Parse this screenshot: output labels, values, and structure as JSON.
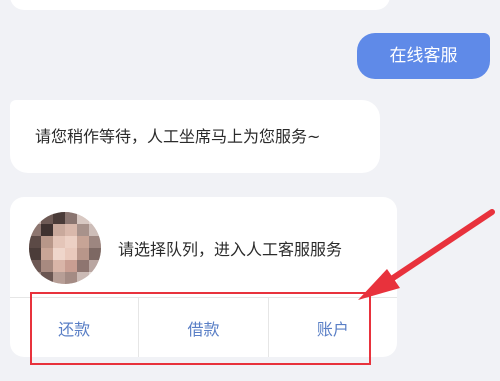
{
  "chat": {
    "user_message": "在线客服",
    "agent_message": "请您稍作等待，人工坐席马上为您服务~",
    "queue_prompt": "请选择队列，进入人工客服服务",
    "options": [
      "还款",
      "借款",
      "账户"
    ]
  },
  "colors": {
    "user_bubble": "#5f8ae8",
    "option_text": "#5a7fc6",
    "annotation_red": "#e8323c",
    "background": "#f1f2f6"
  }
}
